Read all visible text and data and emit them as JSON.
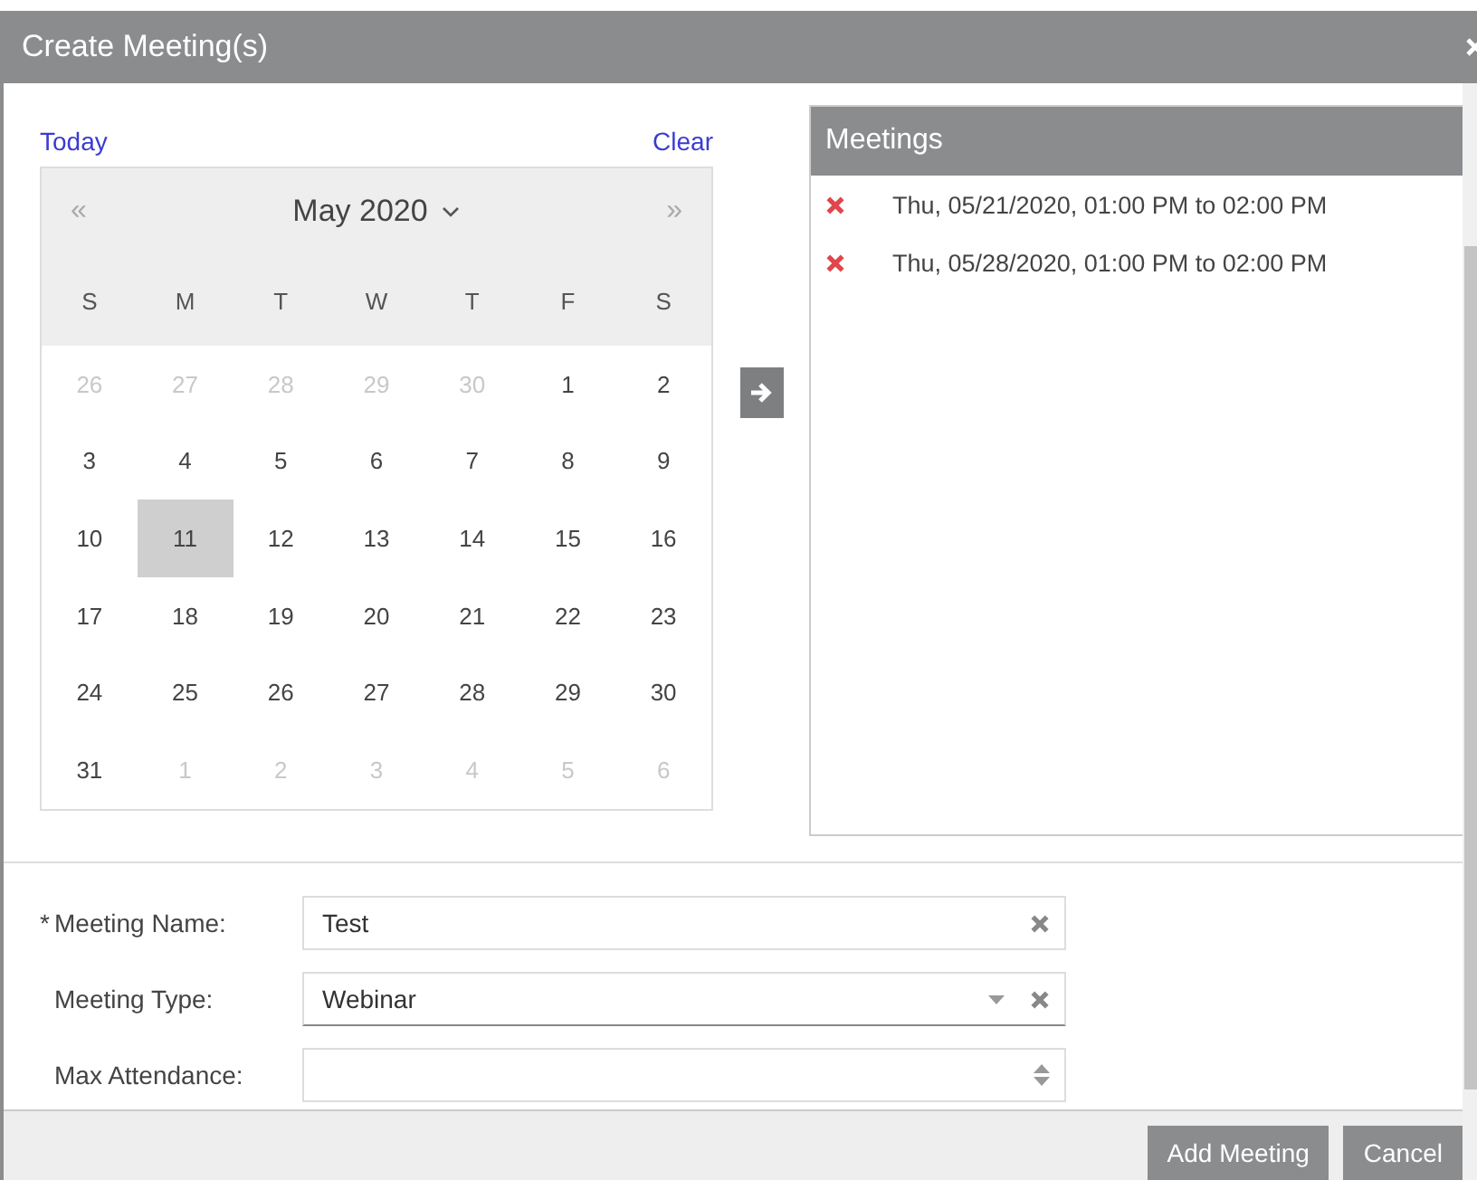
{
  "window": {
    "title": "Create Meeting(s)"
  },
  "calendar": {
    "today_link": "Today",
    "clear_link": "Clear",
    "prev": "«",
    "next": "»",
    "month": "May 2020",
    "weekdays": [
      "S",
      "M",
      "T",
      "W",
      "T",
      "F",
      "S"
    ],
    "weeks": [
      [
        {
          "day": "26",
          "muted": true,
          "selected": false
        },
        {
          "day": "27",
          "muted": true,
          "selected": false
        },
        {
          "day": "28",
          "muted": true,
          "selected": false
        },
        {
          "day": "29",
          "muted": true,
          "selected": false
        },
        {
          "day": "30",
          "muted": true,
          "selected": false
        },
        {
          "day": "1",
          "muted": false,
          "selected": false
        },
        {
          "day": "2",
          "muted": false,
          "selected": false
        }
      ],
      [
        {
          "day": "3",
          "muted": false,
          "selected": false
        },
        {
          "day": "4",
          "muted": false,
          "selected": false
        },
        {
          "day": "5",
          "muted": false,
          "selected": false
        },
        {
          "day": "6",
          "muted": false,
          "selected": false
        },
        {
          "day": "7",
          "muted": false,
          "selected": false
        },
        {
          "day": "8",
          "muted": false,
          "selected": false
        },
        {
          "day": "9",
          "muted": false,
          "selected": false
        }
      ],
      [
        {
          "day": "10",
          "muted": false,
          "selected": false
        },
        {
          "day": "11",
          "muted": false,
          "selected": true
        },
        {
          "day": "12",
          "muted": false,
          "selected": false
        },
        {
          "day": "13",
          "muted": false,
          "selected": false
        },
        {
          "day": "14",
          "muted": false,
          "selected": false
        },
        {
          "day": "15",
          "muted": false,
          "selected": false
        },
        {
          "day": "16",
          "muted": false,
          "selected": false
        }
      ],
      [
        {
          "day": "17",
          "muted": false,
          "selected": false
        },
        {
          "day": "18",
          "muted": false,
          "selected": false
        },
        {
          "day": "19",
          "muted": false,
          "selected": false
        },
        {
          "day": "20",
          "muted": false,
          "selected": false
        },
        {
          "day": "21",
          "muted": false,
          "selected": false
        },
        {
          "day": "22",
          "muted": false,
          "selected": false
        },
        {
          "day": "23",
          "muted": false,
          "selected": false
        }
      ],
      [
        {
          "day": "24",
          "muted": false,
          "selected": false
        },
        {
          "day": "25",
          "muted": false,
          "selected": false
        },
        {
          "day": "26",
          "muted": false,
          "selected": false
        },
        {
          "day": "27",
          "muted": false,
          "selected": false
        },
        {
          "day": "28",
          "muted": false,
          "selected": false
        },
        {
          "day": "29",
          "muted": false,
          "selected": false
        },
        {
          "day": "30",
          "muted": false,
          "selected": false
        }
      ],
      [
        {
          "day": "31",
          "muted": false,
          "selected": false
        },
        {
          "day": "1",
          "muted": true,
          "selected": false
        },
        {
          "day": "2",
          "muted": true,
          "selected": false
        },
        {
          "day": "3",
          "muted": true,
          "selected": false
        },
        {
          "day": "4",
          "muted": true,
          "selected": false
        },
        {
          "day": "5",
          "muted": true,
          "selected": false
        },
        {
          "day": "6",
          "muted": true,
          "selected": false
        }
      ]
    ]
  },
  "meetings": {
    "title": "Meetings",
    "items": [
      {
        "text": "Thu, 05/21/2020, 01:00 PM to 02:00 PM"
      },
      {
        "text": "Thu, 05/28/2020, 01:00 PM to 02:00 PM"
      }
    ]
  },
  "form": [
    {
      "kind": "text",
      "required_mark": "*",
      "label": "Meeting Name:",
      "value": "Test"
    },
    {
      "kind": "select",
      "label": "Meeting Type:",
      "value": "Webinar"
    },
    {
      "kind": "number",
      "label": "Max Attendance:"
    }
  ],
  "buttons": [
    "Add Meeting",
    "Cancel"
  ]
}
